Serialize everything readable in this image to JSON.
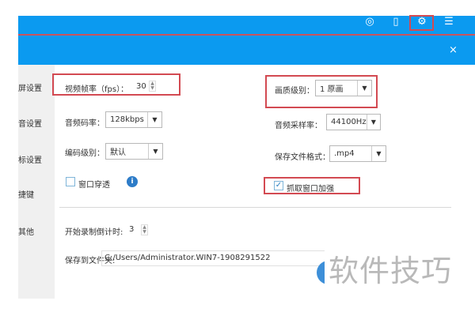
{
  "topbar": {
    "icons": [
      "user-circle-icon",
      "phone-icon",
      "gear-icon",
      "menu-icon"
    ],
    "close": "×",
    "accent": "#0b9af0"
  },
  "sidebar": {
    "items": [
      {
        "label": "屏设置"
      },
      {
        "label": "音设置"
      },
      {
        "label": "标设置"
      },
      {
        "label": "捷键"
      },
      {
        "label": "其他"
      }
    ]
  },
  "settings": {
    "fps": {
      "label": "视频帧率（fps）：",
      "value": "30"
    },
    "quality": {
      "label": "画质级别：",
      "value": "1 原画"
    },
    "audio_bitrate": {
      "label": "音频码率：",
      "value": "128kbps"
    },
    "audio_sample": {
      "label": "音频采样率：",
      "value": "44100Hz"
    },
    "encode_level": {
      "label": "编码级别：",
      "value": "默认"
    },
    "file_format": {
      "label": "保存文件格式：",
      "value": ".mp4"
    },
    "window_through": {
      "label": "窗口穿透",
      "checked": false
    },
    "capture_enhance": {
      "label": "抓取窗口加强",
      "checked": true
    },
    "countdown": {
      "label": "开始录制倒计时:",
      "value": "3"
    },
    "save_folder": {
      "label": "保存到文件夹:",
      "value": "C:/Users/Administrator.WIN7-1908291522"
    }
  },
  "watermark": "软件技巧",
  "highlight_color": "#d34a52"
}
